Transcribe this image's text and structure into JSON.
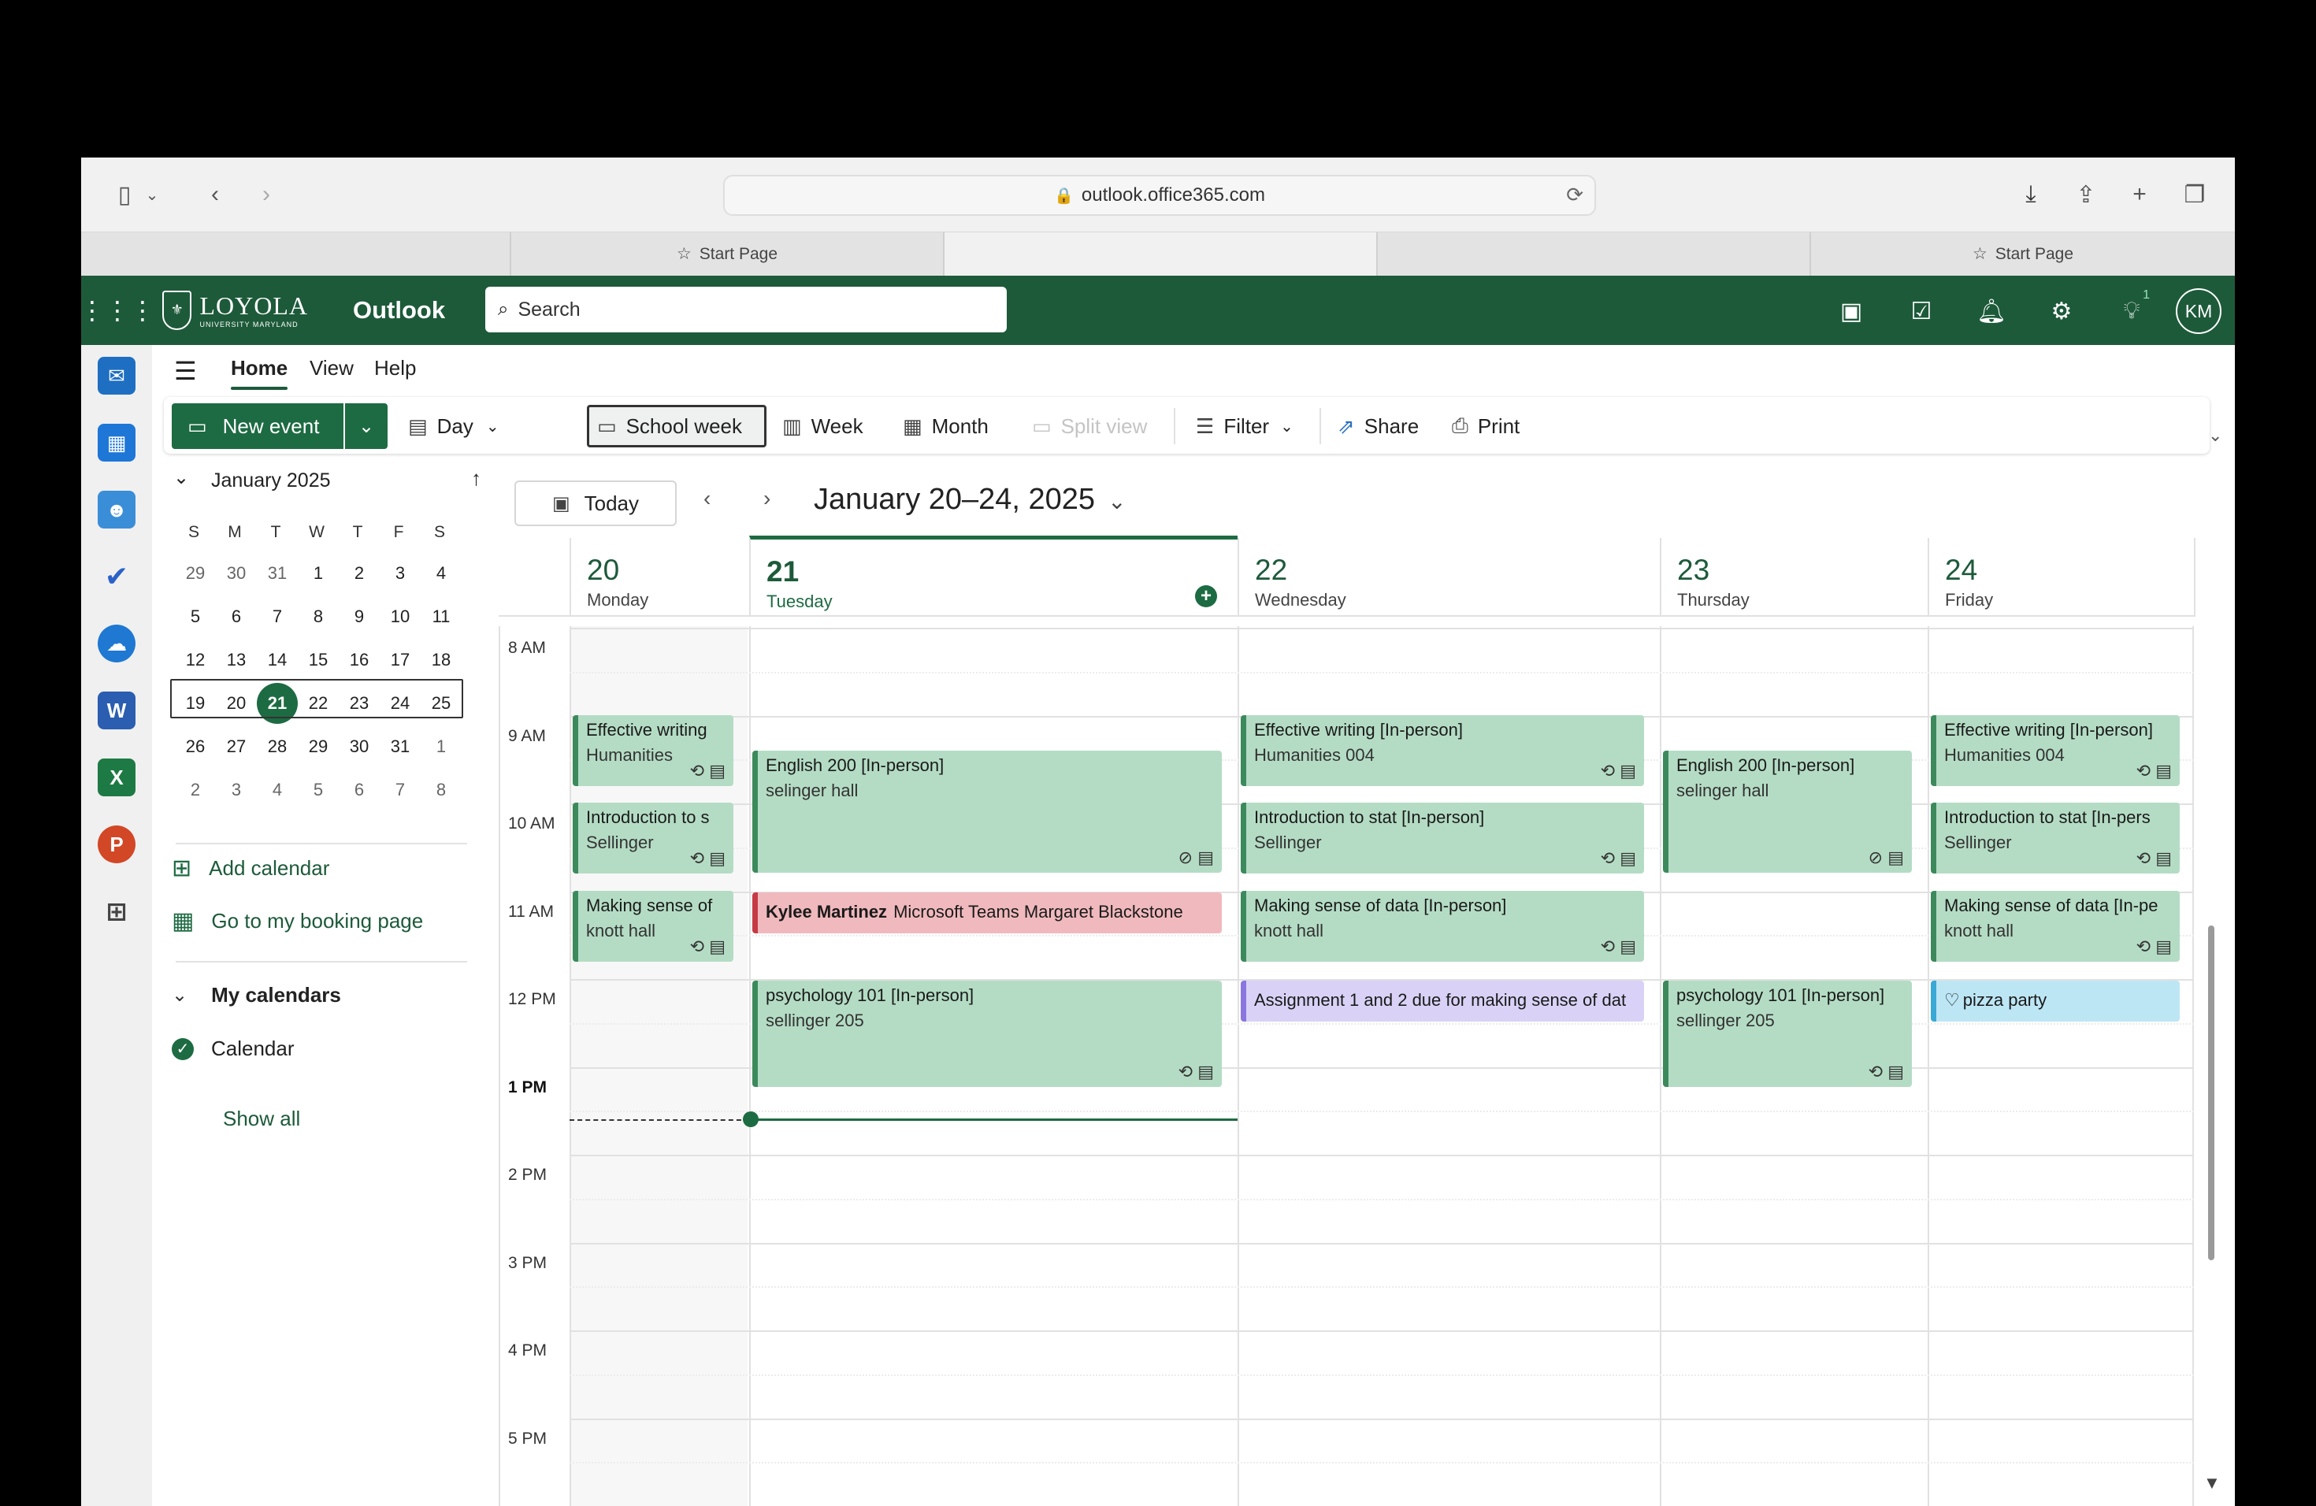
{
  "browser": {
    "url": "outlook.office365.com",
    "tabs": [
      {
        "label": "Start Page"
      },
      {
        "label": ""
      },
      {
        "label": "Start Page"
      }
    ]
  },
  "header": {
    "logo_text": "LOYOLA",
    "logo_sub": "UNIVERSITY MARYLAND",
    "app_name": "Outlook",
    "search_placeholder": "Search",
    "notification_badge": "1",
    "avatar_initials": "KM"
  },
  "ribbon": {
    "tabs": [
      "Home",
      "View",
      "Help"
    ],
    "new_event": "New event",
    "day": "Day",
    "school_week": "School week",
    "week": "Week",
    "month": "Month",
    "split_view": "Split view",
    "filter": "Filter",
    "share": "Share",
    "print": "Print"
  },
  "minical": {
    "title": "January 2025",
    "weekday_headers": [
      "S",
      "M",
      "T",
      "W",
      "T",
      "F",
      "S"
    ],
    "weeks": [
      [
        "29",
        "30",
        "31",
        "1",
        "2",
        "3",
        "4"
      ],
      [
        "5",
        "6",
        "7",
        "8",
        "9",
        "10",
        "11"
      ],
      [
        "12",
        "13",
        "14",
        "15",
        "16",
        "17",
        "18"
      ],
      [
        "19",
        "20",
        "21",
        "22",
        "23",
        "24",
        "25"
      ],
      [
        "26",
        "27",
        "28",
        "29",
        "30",
        "31",
        "1"
      ],
      [
        "2",
        "3",
        "4",
        "5",
        "6",
        "7",
        "8"
      ]
    ],
    "today": "21"
  },
  "sidebar": {
    "add_calendar": "Add calendar",
    "booking_page": "Go to my booking page",
    "my_calendars": "My calendars",
    "calendar": "Calendar",
    "show_all": "Show all"
  },
  "calendar": {
    "today_button": "Today",
    "range_title": "January 20–24, 2025",
    "days": [
      {
        "num": "20",
        "name": "Monday"
      },
      {
        "num": "21",
        "name": "Tuesday"
      },
      {
        "num": "22",
        "name": "Wednesday"
      },
      {
        "num": "23",
        "name": "Thursday"
      },
      {
        "num": "24",
        "name": "Friday"
      }
    ],
    "hours": [
      "8 AM",
      "9 AM",
      "10 AM",
      "11 AM",
      "12 PM",
      "1 PM",
      "2 PM",
      "3 PM",
      "4 PM",
      "5 PM"
    ],
    "events": {
      "mon_1": {
        "title": "Effective writing",
        "loc": "Humanities"
      },
      "mon_2": {
        "title": "Introduction to s",
        "loc": "Sellinger"
      },
      "mon_3": {
        "title": "Making sense of",
        "loc": "knott hall"
      },
      "tue_1": {
        "title": "English 200 [In-person]",
        "loc": "selinger hall"
      },
      "tue_2": {
        "title": "Kylee Martinez",
        "loc": "Microsoft Teams Margaret Blackstone"
      },
      "tue_3": {
        "title": "psychology 101 [In-person]",
        "loc": "sellinger 205"
      },
      "wed_1": {
        "title": "Effective writing [In-person]",
        "loc": "Humanities 004"
      },
      "wed_2": {
        "title": "Introduction to stat [In-person]",
        "loc": "Sellinger"
      },
      "wed_3": {
        "title": "Making sense of data [In-person]",
        "loc": "knott hall"
      },
      "wed_4": {
        "title": "Assignment 1 and 2 due for making sense of dat"
      },
      "thu_1": {
        "title": "English 200 [In-person]",
        "loc": "selinger hall"
      },
      "thu_2": {
        "title": "psychology 101 [In-person]",
        "loc": "sellinger 205"
      },
      "fri_1": {
        "title": "Effective writing [In-person]",
        "loc": "Humanities 004"
      },
      "fri_2": {
        "title": "Introduction to stat [In-pers",
        "loc": "Sellinger"
      },
      "fri_3": {
        "title": "Making sense of data [In-pe",
        "loc": "knott hall"
      },
      "fri_4": {
        "title": "pizza party"
      }
    }
  },
  "colors": {
    "brand": "#1d5a3a",
    "event_green": "#b4dcc4",
    "event_red": "#f0b9bd",
    "event_purple": "#d9d2f6",
    "event_blue": "#bde6f5"
  }
}
